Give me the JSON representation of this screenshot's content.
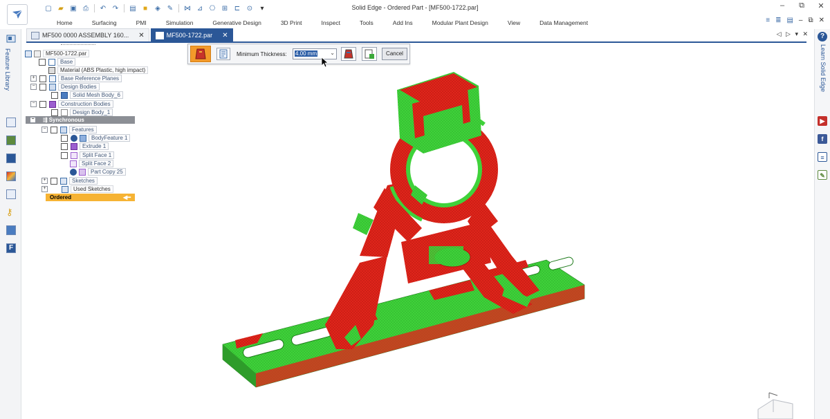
{
  "window": {
    "title": "Solid Edge - Ordered Part - [MF500-1722.par]",
    "controls": [
      "–",
      "⧉",
      "✕"
    ]
  },
  "quick_access": {
    "icons": [
      "new-icon",
      "open-icon",
      "save-icon",
      "print-icon",
      "undo-icon",
      "redo-icon",
      "customize-icon"
    ]
  },
  "ribbon": {
    "tabs": [
      "Home",
      "Surfacing",
      "PMI",
      "Simulation",
      "Generative Design",
      "3D Print",
      "Inspect",
      "Tools",
      "Add Ins",
      "Modular Plant Design",
      "View",
      "Data Management"
    ]
  },
  "documents": {
    "tabs": [
      {
        "label": "MF500 0000 ASSEMBLY 160...",
        "active": false
      },
      {
        "label": "MF500-1722.par",
        "active": true
      }
    ],
    "right_controls": "◁ ▷ ▾ ✕"
  },
  "left_bar": {
    "feature_library_label": "Feature Library"
  },
  "right_bar": {
    "help_label": "?",
    "learn_label": "Learn Solid Edge",
    "icons": [
      "youtube-icon",
      "facebook-icon",
      "community-icon",
      "notes-icon"
    ]
  },
  "tree": {
    "root": "MF500-1722.par",
    "base": "Base",
    "material": "Material (ABS Plastic, high impact)",
    "base_reference_planes": "Base Reference Planes",
    "design_bodies": "Design Bodies",
    "solid_mesh_body": "Solid Mesh Body_6",
    "construction_bodies": "Construction Bodies",
    "design_body": "Design Body_1",
    "synchronous": "Synchronous",
    "features": "Features",
    "body_feature": "BodyFeature 1",
    "extrude": "Extrude 1",
    "split_face_1": "Split Face 1",
    "split_face_2": "Split Face 2",
    "part_copy": "Part Copy 25",
    "sketches": "Sketches",
    "used_sketches": "Used Sketches",
    "ordered": "Ordered"
  },
  "command_bar": {
    "label": "Minimum Thickness:",
    "thickness_value": "4.00 mm",
    "cancel_label": "Cancel"
  },
  "colors": {
    "accent": "#2b5797",
    "thin_region": "#e0251b",
    "ok_region": "#3fd23a",
    "ordered_highlight": "#f6b334",
    "active_step": "#f39a2a"
  }
}
